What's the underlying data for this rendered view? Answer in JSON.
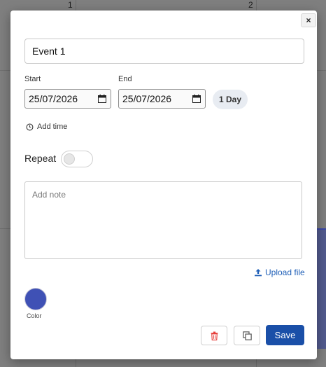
{
  "background": {
    "day_numbers": [
      "1",
      "2"
    ]
  },
  "dialog": {
    "close_label": "×",
    "title_value": "Event 1",
    "start_label": "Start",
    "end_label": "End",
    "start_date": "25/07/2026",
    "end_date": "25/07/2026",
    "duration": "1 Day",
    "add_time": "Add time",
    "repeat_label": "Repeat",
    "repeat_on": false,
    "note_placeholder": "Add note",
    "upload_label": "Upload file",
    "color_label": "Color",
    "color_value": "#3f51b5",
    "save_label": "Save"
  },
  "colors": {
    "accent": "#1a4fa8",
    "link": "#1f5fb7",
    "delete": "#e53935"
  },
  "icons": {
    "close": "close-icon",
    "calendar": "calendar-icon",
    "clock": "clock-icon",
    "upload": "upload-icon",
    "delete": "trash-icon",
    "duplicate": "copy-icon"
  }
}
